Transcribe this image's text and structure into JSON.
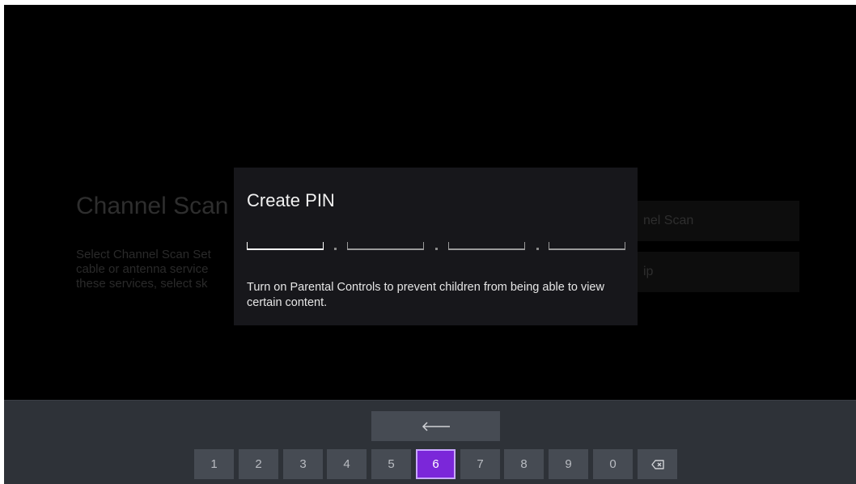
{
  "background": {
    "title": "Channel Scan",
    "description_lines": [
      "Select Channel Scan Set",
      "cable or antenna service",
      "these services, select sk"
    ],
    "option_1": "nel Scan",
    "option_2": "ip"
  },
  "dialog": {
    "title": "Create PIN",
    "pin_slots": 4,
    "message": "Turn on Parental Controls to prevent children from being able to view certain content."
  },
  "keyboard": {
    "enter_icon": "enter-arrow-icon",
    "keys": [
      "1",
      "2",
      "3",
      "4",
      "5",
      "6",
      "7",
      "8",
      "9",
      "0"
    ],
    "selected_key": "6",
    "backspace_icon": "backspace-icon"
  },
  "colors": {
    "accent": "#7b27d9",
    "dialog_bg": "#17171b",
    "keyboard_bg": "#2e3238"
  }
}
